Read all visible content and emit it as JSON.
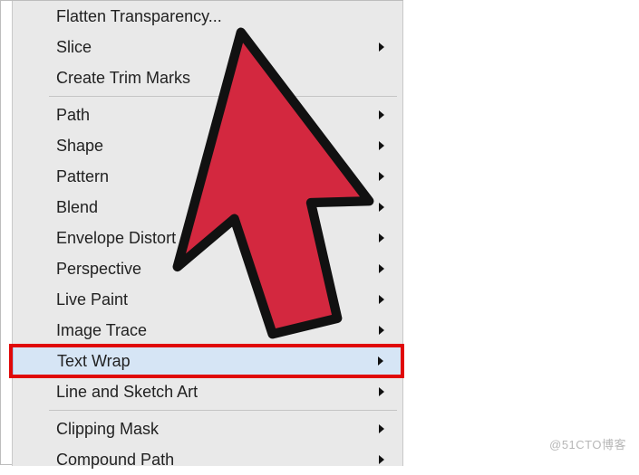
{
  "menu": {
    "items": [
      {
        "label": "Flatten Transparency...",
        "submenu": false
      },
      {
        "label": "Slice",
        "submenu": true
      },
      {
        "label": "Create Trim Marks",
        "submenu": false
      },
      {
        "sep": true
      },
      {
        "label": "Path",
        "submenu": true
      },
      {
        "label": "Shape",
        "submenu": true
      },
      {
        "label": "Pattern",
        "submenu": true
      },
      {
        "label": "Blend",
        "submenu": true
      },
      {
        "label": "Envelope Distort",
        "submenu": true
      },
      {
        "label": "Perspective",
        "submenu": true
      },
      {
        "label": "Live Paint",
        "submenu": true
      },
      {
        "label": "Image Trace",
        "submenu": true
      },
      {
        "label": "Text Wrap",
        "submenu": true,
        "highlight": true,
        "redbox": true
      },
      {
        "label": "Line and Sketch Art",
        "submenu": true
      },
      {
        "sep": true
      },
      {
        "label": "Clipping Mask",
        "submenu": true
      },
      {
        "label": "Compound Path",
        "submenu": true
      }
    ]
  },
  "watermark": "@51CTO博客",
  "icons": {
    "arrow_color": "#d3283f"
  }
}
